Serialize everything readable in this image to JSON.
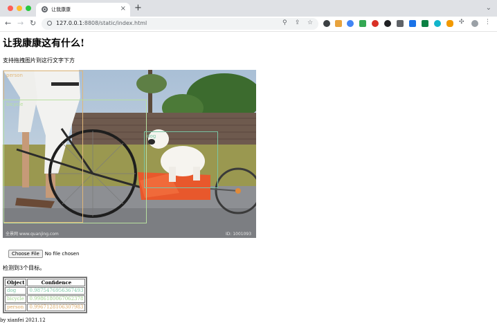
{
  "browser": {
    "tab_title": "让我康康",
    "tab_close": "×",
    "new_tab": "+",
    "url_host": "127.0.0.1",
    "url_path": ":8808/static/index.html"
  },
  "page": {
    "title": "让我康康这有什么!",
    "drop_hint": "支持拖拽图片到这行文字下方",
    "choose_file_label": "Choose File",
    "file_status": "No file chosen",
    "result_summary": "检测到3个目标。",
    "footer": "by xianfei 2021.12",
    "photo_watermark_left": "全景网 www.quanjing.com",
    "photo_watermark_right": "ID: 1001093"
  },
  "detections": [
    {
      "label": "dog",
      "confidence": "0.9875476956367493",
      "color": "#7ac6a5"
    },
    {
      "label": "bicycle",
      "confidence": "0.9986180067062378",
      "color": "#b8e0a0"
    },
    {
      "label": "person",
      "confidence": "0.9967128106307983",
      "color": "#e0b77a"
    }
  ],
  "table_headers": {
    "object": "Object",
    "confidence": "Confidence"
  },
  "colors": {
    "tabstrip": "#dfe1e5",
    "omnibox": "#f1f3f4"
  }
}
